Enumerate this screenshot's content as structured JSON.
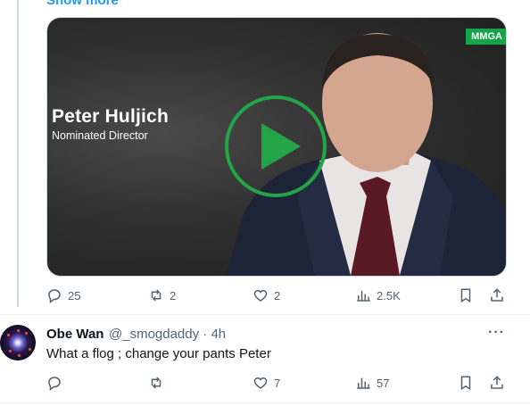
{
  "post": {
    "show_more": "Show more",
    "video": {
      "badge": "MMGA",
      "caption_name": "Peter Huljich",
      "caption_role": "Nominated Director"
    },
    "stats": {
      "replies": "25",
      "reposts": "2",
      "likes": "2",
      "views": "2.5K"
    }
  },
  "reply": {
    "name": "Obe Wan",
    "handle": "@_smogdaddy · 4h",
    "text": "What a flog ; change your pants Peter",
    "stats": {
      "replies": "",
      "reposts": "",
      "likes": "7",
      "views": "57"
    }
  },
  "colors": {
    "play_ring": "#22a447",
    "badge": "#16a34a",
    "link": "#1d9bf0",
    "muted": "#536471"
  },
  "icons": [
    "reply-icon",
    "repost-icon",
    "like-icon",
    "views-icon",
    "bookmark-icon",
    "share-icon",
    "play-icon",
    "more-icon"
  ]
}
